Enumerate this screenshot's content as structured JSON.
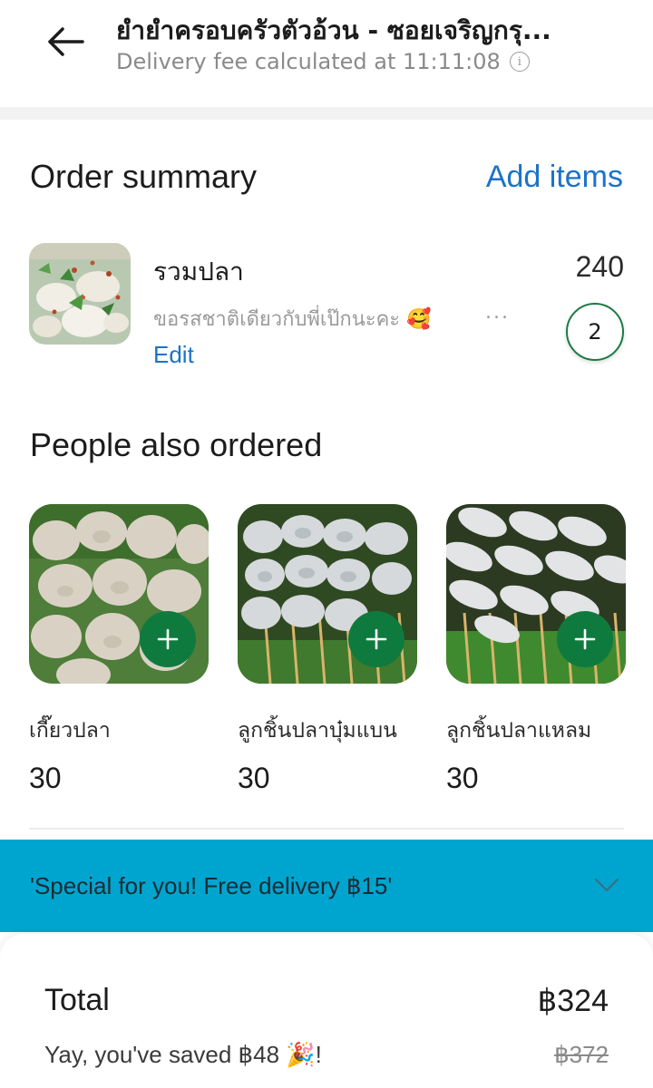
{
  "header": {
    "title": "ยำยำครอบครัวตัวอ้วน - ซอยเจริญกรุ...",
    "subtitle": "Delivery fee calculated at 11:11:08",
    "info_symbol": "i"
  },
  "order_summary": {
    "title": "Order summary",
    "add_items_label": "Add items",
    "items": [
      {
        "name": "รวมปลา",
        "note": "ขอรสชาติเดียวกับพี่เป๊กนะคะ 🥰",
        "more": "...",
        "edit_label": "Edit",
        "price": "240",
        "quantity": "2"
      }
    ]
  },
  "people_also_ordered": {
    "title": "People also ordered",
    "items": [
      {
        "name": "เกี๊ยวปลา",
        "price": "30"
      },
      {
        "name": "ลูกชิ้นปลาบุ๋มแบน",
        "price": "30"
      },
      {
        "name": "ลูกชิ้นปลาแหลม",
        "price": "30"
      }
    ]
  },
  "promo": {
    "text": "'Special for you! Free delivery ฿15'"
  },
  "totals": {
    "total_label": "Total",
    "total_value": "฿324",
    "saved_text": "Yay, you've saved ฿48 🎉!",
    "original_value": "฿372"
  },
  "colors": {
    "accent_blue": "#1a73c9",
    "brand_green": "#0f7a3e",
    "promo_bg": "#00a5cf"
  }
}
